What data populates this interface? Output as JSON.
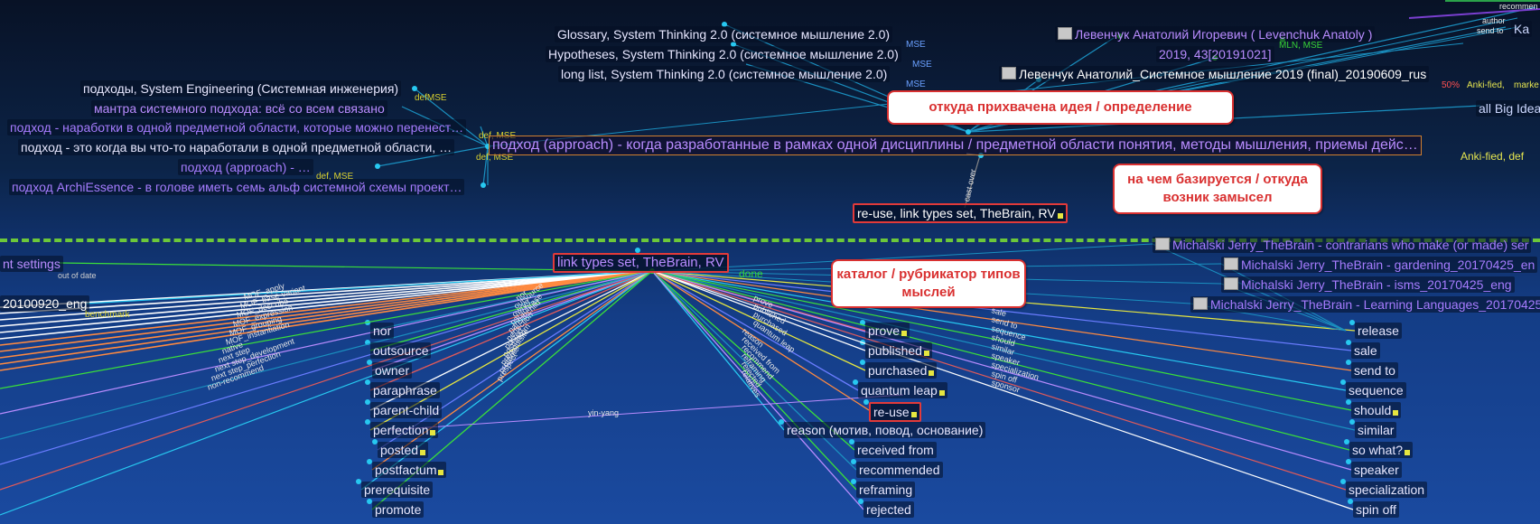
{
  "app": "TheBrain",
  "top": {
    "nodes": [
      {
        "id": "glossary",
        "text": "Glossary, System Thinking 2.0 (системное мышление 2.0)"
      },
      {
        "id": "hypotheses",
        "text": "Hypotheses, System Thinking 2.0 (системное мышление 2.0)"
      },
      {
        "id": "longlist",
        "text": "long list, System Thinking 2.0 (системное мышление 2.0)"
      },
      {
        "id": "author",
        "text": "Левенчук Анатолий Игоревич ( Levenchuk Anatoly )"
      },
      {
        "id": "year",
        "text": "2019, 43[20191021]"
      },
      {
        "id": "book",
        "text": "Левенчук Анатолий_Системное мышление 2019 (final)_20190609_rus"
      },
      {
        "id": "allbig",
        "text": "all Big Idea"
      },
      {
        "id": "approaches",
        "text": "подходы, System Engineering (Системная инженерия)"
      },
      {
        "id": "mantra",
        "text": "мантра системного подхода: всё со всем связано"
      },
      {
        "id": "dev1",
        "text": "подход - наработки в одной предметной области, которые можно перенест…"
      },
      {
        "id": "dev2",
        "text": "подход - это когда вы что-то наработали в одной предметной области, …"
      },
      {
        "id": "dev3",
        "text": "подход (approach) - …"
      },
      {
        "id": "dev4",
        "text": "подход ArchiEssence - в голове иметь семь альф системной схемы проект…"
      },
      {
        "id": "reuse_top",
        "text": "re-use, link types set, TheBrain, RV"
      }
    ],
    "active_thought": "подход (approach) - когда разработанные в рамках одной дисциплины / предметной области понятия, методы мышления, приемы дейс…",
    "tags": {
      "mse": "MSE",
      "def": "def",
      "def_mse": "def, MSE",
      "mln_mse": "MLN, MSE",
      "percent": "50%",
      "anki": "Anki-fied,",
      "anki_def": "Anki-fied,  def",
      "markers": "marke",
      "recommen": "recommen",
      "author_lbl": "author",
      "send_to_lbl": "send to",
      "ka": "Ka",
      "cast_over": "cast over"
    }
  },
  "callouts": {
    "c1": "откуда прихвачена идея / определение",
    "c2": "на чем базируется / откуда возник замысел",
    "c3": "каталог / рубрикатор типов мыслей"
  },
  "bottom": {
    "center": "link types set, TheBrain, RV",
    "done": "done",
    "left_nodes": [
      "nor",
      "outsource",
      "owner",
      "paraphrase",
      "parent-child",
      "perfection",
      "posted",
      "postfactum",
      "prerequisite",
      "promote"
    ],
    "mid_nodes": [
      "prove",
      "published",
      "purchased",
      "quantum leap",
      "re-use",
      "reason (мотив, повод, основание)",
      "received from",
      "recommended",
      "reframing",
      "rejected"
    ],
    "right_nodes": [
      "release",
      "sale",
      "send to",
      "sequence",
      "should",
      "similar",
      "so what?",
      "speaker",
      "specialization",
      "spin off"
    ],
    "michalski": [
      "Michalski Jerry_TheBrain - contrarians who make (or made) ser",
      "Michalski Jerry_TheBrain - gardening_20170425_en",
      "Michalski Jerry_TheBrain - isms_20170425_eng",
      "Michalski Jerry_TheBrain - Learning Languages_20170425"
    ],
    "settings": "nt settings",
    "out_of_date": "out of date",
    "eng": "20100920_eng",
    "benchmark": "benchmark",
    "yinyang": "yin-yang",
    "left_link_labels": [
      "MOF_apply",
      "MOF_base-variant",
      "MOF_describe",
      "MOF_expression",
      "MOF_grouping",
      "MOF_instantiation",
      "native",
      "next step",
      "next step_development",
      "next step_perfection",
      "non-recommend"
    ],
    "center_link_labels_left": [
      "nor",
      "outsource",
      "owner",
      "paraphrase",
      "parent-child",
      "perfection",
      "posted",
      "postfactum",
      "prerequisite",
      "promote",
      "prospect"
    ],
    "center_link_labels_right": [
      "prove",
      "published",
      "purchased",
      "quantum leap",
      "reason",
      "received from",
      "recommend",
      "reframing",
      "rejected",
      "relatives"
    ],
    "right_link_labels": [
      "sale",
      "send to",
      "sequence",
      "should",
      "similar",
      "speaker",
      "specialization",
      "spin off",
      "sponsor"
    ]
  },
  "colors": {
    "background_top": "#081226",
    "background_bottom": "#1a4aa0",
    "accent_purple": "#b98cff",
    "callout_red": "#d93030",
    "divider_green": "#6cc83a"
  }
}
